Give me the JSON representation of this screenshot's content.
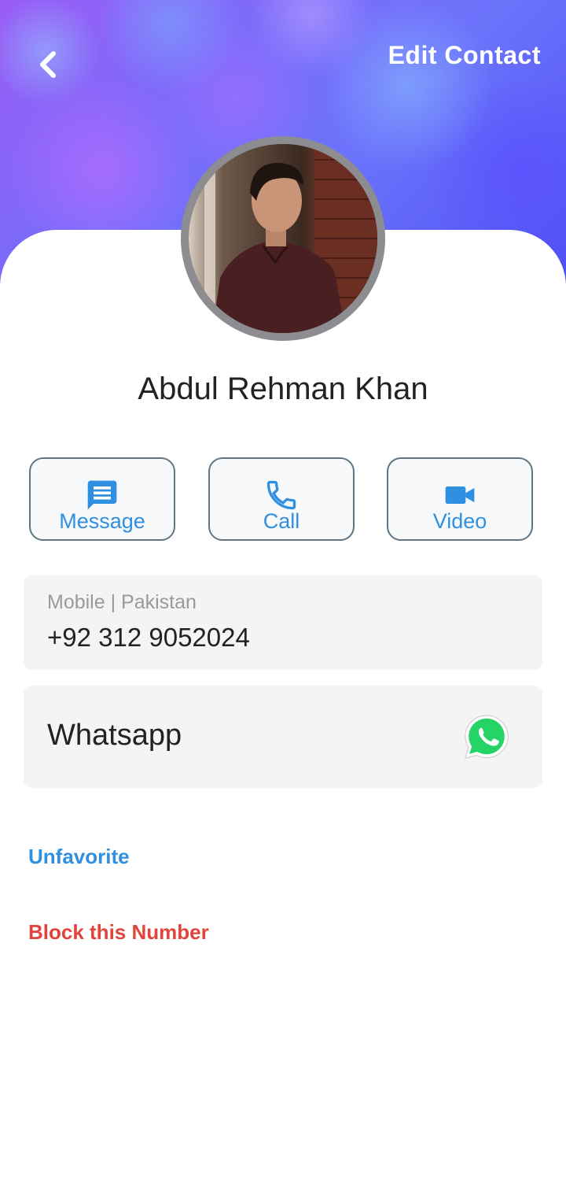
{
  "header": {
    "back_icon": "chevron-left-icon",
    "edit_label": "Edit Contact"
  },
  "contact": {
    "name": "Abdul Rehman Khan",
    "avatar": "profile-photo"
  },
  "actions": [
    {
      "label": "Message",
      "icon": "message-icon"
    },
    {
      "label": "Call",
      "icon": "phone-icon"
    },
    {
      "label": "Video",
      "icon": "videocam-icon"
    }
  ],
  "phone": {
    "type_label": "Mobile | Pakistan",
    "number": "+92 312 9052024"
  },
  "whatsapp": {
    "label": "Whatsapp",
    "icon": "whatsapp-icon"
  },
  "options": {
    "unfavorite": "Unfavorite",
    "block": "Block this Number"
  },
  "colors": {
    "accent": "#2f8fe0",
    "danger": "#e0443a",
    "whatsapp_green": "#25d366",
    "button_border": "#5e7582"
  }
}
